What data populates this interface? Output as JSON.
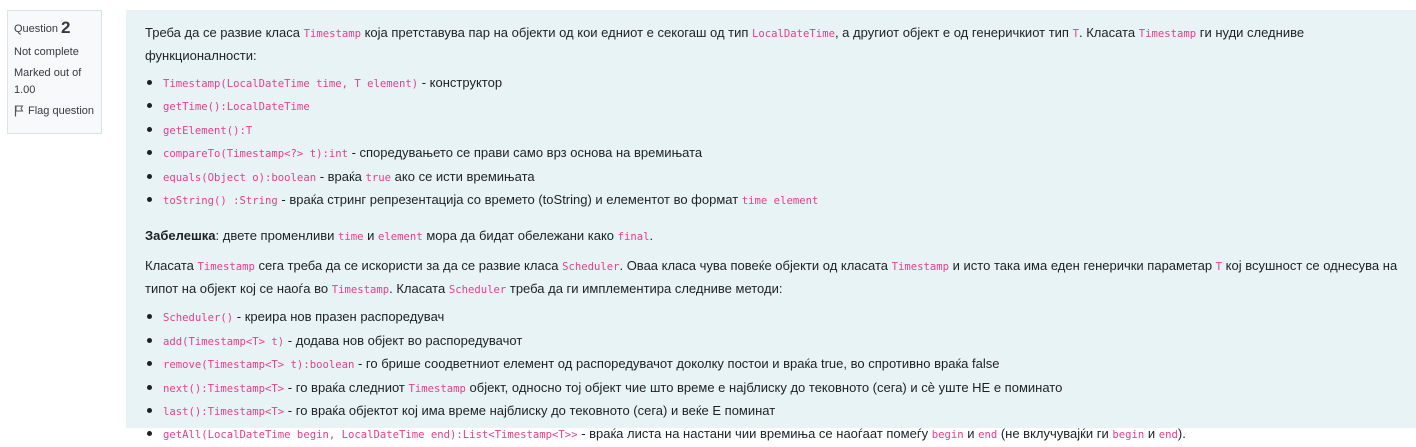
{
  "question_info": {
    "label": "Question",
    "number": "2",
    "status": "Not complete",
    "marked_out_of": "Marked out of 1.00",
    "flag_label": "Flag question"
  },
  "intro": {
    "t1": "Треба да се развие класа ",
    "c1": "Timestamp",
    "t2": " која претставува пар на објекти од кои едниот е секогаш од тип ",
    "c2": "LocalDateTime",
    "t3": ", а другиот објект е од генеричкиот тип ",
    "c3": "T",
    "t4": ". Класата ",
    "c4": "Timestamp",
    "t5": " ги нуди следниве функционалности:"
  },
  "timestamp_methods": [
    {
      "code": "Timestamp(LocalDateTime time, T element)",
      "text": " - конструктор"
    },
    {
      "code": "getTime():LocalDateTime",
      "text": ""
    },
    {
      "code": "getElement():T",
      "text": ""
    },
    {
      "code": "compareTo(Timestamp<?> t):int",
      "text": " - споредувањето се прави само врз основа на времињата"
    },
    {
      "code": "equals(Object o):boolean",
      "text": " - враќа ",
      "code2": "true",
      "text2": " ако се исти времињата"
    },
    {
      "code": "toString() :String",
      "text": " - враќа стринг репрезентација со времето (toString) и елементот во формат ",
      "code2": "time element",
      "text2": ""
    }
  ],
  "note": {
    "bold": "Забелешка",
    "t1": ": двете променливи ",
    "c1": "time",
    "t2": " и ",
    "c2": "element",
    "t3": " мора да бидат обележани како ",
    "c3": "final",
    "t4": "."
  },
  "scheduler_intro": {
    "t1": "Класата ",
    "c1": "Timestamp",
    "t2": " сега треба да се искористи за да се развие класа ",
    "c2": "Scheduler",
    "t3": ". Оваа класа чува повеќе објекти од класата ",
    "c3": "Timestamp",
    "t4": " и исто така има еден генерички параметар ",
    "c4": "T",
    "t5": " кој всушност се однесува на типот на објект кој се наоѓа во ",
    "c5": "Timestamp",
    "t6": ". Класата ",
    "c6": "Scheduler",
    "t7": " треба да ги имплементира следниве методи:"
  },
  "scheduler_methods": [
    {
      "code": "Scheduler()",
      "text": " - креира нов празен распоредувач"
    },
    {
      "code": "add(Timestamp<T> t)",
      "text": " - додава нов објект во распоредувачот"
    },
    {
      "code": "remove(Timestamp<T> t):boolean",
      "text": " - го брише соодветниот елемент од распоредувачот доколку постои и враќа true, во спротивно враќа false"
    },
    {
      "code": "next():Timestamp<T>",
      "text": " - го враќа следниот ",
      "code2": "Timestamp",
      "text2": " објект, односно тој објект чие што време е најблиску до тековното (сега) и сѐ уште НЕ е поминато"
    },
    {
      "code": "last():Timestamp<T>",
      "text": " - го враќа објектот кој има време најблиску до тековното (сега) и веќе Е поминат"
    },
    {
      "code": "getAll(LocalDateTime begin, LocalDateTime end):List<Timestamp<T>>",
      "text": " - враќа листа на настани чии времиња се наоѓаат помеѓу ",
      "code2": "begin",
      "text2": " и ",
      "code3": "end",
      "text3": " (не вклучувајќи ги ",
      "code4": "begin",
      "text4": " и ",
      "code5": "end",
      "text5": ")."
    }
  ]
}
